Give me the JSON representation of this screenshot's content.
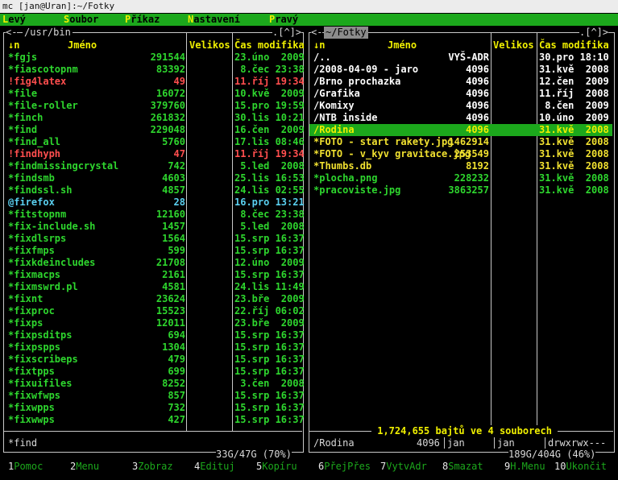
{
  "window": {
    "title": "mc [jan@Uran]:~/Fotky"
  },
  "menu": [
    {
      "hotkey": "L",
      "rest": "evý"
    },
    {
      "hotkey": "S",
      "rest": "oubor"
    },
    {
      "hotkey": "P",
      "rest": "říkaz"
    },
    {
      "hotkey": "N",
      "rest": "astavení"
    },
    {
      "hotkey": "P",
      "rest": "ravý"
    }
  ],
  "left": {
    "path": "/usr/bin",
    "nav_left": "<-",
    "nav_right": ".[^]>",
    "cols": {
      "name": "↓n",
      "name_label": "Jméno",
      "size": "Velikos",
      "time": "Čas modifika"
    },
    "rows": [
      {
        "n": "*fgjs",
        "s": "291544",
        "t": "23.úno  2009",
        "k": "exe"
      },
      {
        "n": "*fiascotopnm",
        "s": "83392",
        "t": " 8.čec 23:38",
        "k": "exe"
      },
      {
        "n": "!fig4latex",
        "s": "49",
        "t": "11.říj 19:34",
        "k": "broken"
      },
      {
        "n": "*file",
        "s": "16072",
        "t": "10.kvě  2009",
        "k": "exe"
      },
      {
        "n": "*file-roller",
        "s": "379760",
        "t": "15.pro 19:59",
        "k": "exe"
      },
      {
        "n": "*finch",
        "s": "261832",
        "t": "30.lis 10:21",
        "k": "exe"
      },
      {
        "n": "*find",
        "s": "229048",
        "t": "16.čen  2009",
        "k": "exe"
      },
      {
        "n": "*find_all",
        "s": "5760",
        "t": "17.lis 08:46",
        "k": "exe"
      },
      {
        "n": "!findhyph",
        "s": "47",
        "t": "11.říj 19:34",
        "k": "broken"
      },
      {
        "n": "*findmissingcrystal",
        "s": "742",
        "t": " 5.led  2008",
        "k": "exe"
      },
      {
        "n": "*findsmb",
        "s": "4603",
        "t": "25.lis 16:53",
        "k": "exe"
      },
      {
        "n": "*findssl.sh",
        "s": "4857",
        "t": "24.lis 02:55",
        "k": "exe"
      },
      {
        "n": "@firefox",
        "s": "28",
        "t": "16.pro 13:21",
        "k": "link"
      },
      {
        "n": "*fitstopnm",
        "s": "12160",
        "t": " 8.čec 23:38",
        "k": "exe"
      },
      {
        "n": "*fix-include.sh",
        "s": "1457",
        "t": " 5.led  2008",
        "k": "exe"
      },
      {
        "n": "*fixdlsrps",
        "s": "1564",
        "t": "15.srp 16:37",
        "k": "exe"
      },
      {
        "n": "*fixfmps",
        "s": "599",
        "t": "15.srp 16:37",
        "k": "exe"
      },
      {
        "n": "*fixkdeincludes",
        "s": "21708",
        "t": "12.úno  2009",
        "k": "exe"
      },
      {
        "n": "*fixmacps",
        "s": "2161",
        "t": "15.srp 16:37",
        "k": "exe"
      },
      {
        "n": "*fixmswrd.pl",
        "s": "4581",
        "t": "24.lis 11:49",
        "k": "exe"
      },
      {
        "n": "*fixnt",
        "s": "23624",
        "t": "23.bře  2009",
        "k": "exe"
      },
      {
        "n": "*fixproc",
        "s": "15523",
        "t": "22.říj 06:02",
        "k": "exe"
      },
      {
        "n": "*fixps",
        "s": "12011",
        "t": "23.bře  2009",
        "k": "exe"
      },
      {
        "n": "*fixpsditps",
        "s": "694",
        "t": "15.srp 16:37",
        "k": "exe"
      },
      {
        "n": "*fixpspps",
        "s": "1304",
        "t": "15.srp 16:37",
        "k": "exe"
      },
      {
        "n": "*fixscribeps",
        "s": "479",
        "t": "15.srp 16:37",
        "k": "exe"
      },
      {
        "n": "*fixtpps",
        "s": "699",
        "t": "15.srp 16:37",
        "k": "exe"
      },
      {
        "n": "*fixuifiles",
        "s": "8252",
        "t": " 3.čen  2008",
        "k": "exe"
      },
      {
        "n": "*fixwfwps",
        "s": "857",
        "t": "15.srp 16:37",
        "k": "exe"
      },
      {
        "n": "*fixwpps",
        "s": "732",
        "t": "15.srp 16:37",
        "k": "exe"
      },
      {
        "n": "*fixwwps",
        "s": "427",
        "t": "15.srp 16:37",
        "k": "exe"
      }
    ],
    "info": "*find",
    "disk": "33G/47G (70%)"
  },
  "right": {
    "path": "~/Fotky",
    "nav_left": "<-",
    "nav_right": ".[^]>",
    "cols": {
      "name": "↓n",
      "name_label": "Jméno",
      "size": "Velikos",
      "time": "Čas modifika"
    },
    "rows": [
      {
        "n": "/..",
        "s": "VYŠ-ADR",
        "t": "30.pro 18:10",
        "k": "dir"
      },
      {
        "n": "/2008-04-09 - jaro",
        "s": "4096",
        "t": "31.kvě  2008",
        "k": "dir"
      },
      {
        "n": "/Brno prochazka",
        "s": "4096",
        "t": "12.čen  2009",
        "k": "dir"
      },
      {
        "n": "/Grafika",
        "s": "4096",
        "t": "11.říj  2008",
        "k": "dir"
      },
      {
        "n": "/Komixy",
        "s": "4096",
        "t": " 8.čen  2009",
        "k": "dir"
      },
      {
        "n": "/NTB inside",
        "s": "4096",
        "t": "10.úno  2009",
        "k": "dir"
      },
      {
        "n": "/Rodina",
        "s": "4096",
        "t": "31.kvě  2008",
        "k": "sel"
      },
      {
        "n": "*FOTO - start rakety.jpg",
        "s": "1462914",
        "t": "31.kvě  2008",
        "k": "yellow"
      },
      {
        "n": "*FOTO - v_kyv gravitace.jpg",
        "s": "253549",
        "t": "31.kvě  2008",
        "k": "yellow"
      },
      {
        "n": "*Thumbs.db",
        "s": "8192",
        "t": "31.kvě  2008",
        "k": "yellow"
      },
      {
        "n": "*plocha.png",
        "s": "228232",
        "t": "31.kvě  2008",
        "k": "exe"
      },
      {
        "n": "*pracoviste.jpg",
        "s": "3863257",
        "t": "31.kvě  2008",
        "k": "exe"
      }
    ],
    "summary": " 1,724,655 bajtů ve 4 souborech ",
    "info": "/Rodina",
    "info_size": "4096",
    "info_user": "jan",
    "info_group": "jan",
    "info_perm": "drwxrwx---",
    "disk": "189G/404G (46%)"
  },
  "fkeys": [
    {
      "num": "1",
      "label": "Pomoc"
    },
    {
      "num": "2",
      "label": "Menu"
    },
    {
      "num": "3",
      "label": "Zobraz"
    },
    {
      "num": "4",
      "label": "Edituj"
    },
    {
      "num": "5",
      "label": "Kopíru"
    },
    {
      "num": "6",
      "label": "PřejPřes"
    },
    {
      "num": "7",
      "label": "VytvAdr"
    },
    {
      "num": "8",
      "label": "Smazat"
    },
    {
      "num": "9",
      "label": "H.Menu"
    },
    {
      "num": "10",
      "label": "Ukončit"
    }
  ],
  "colors": {
    "accent": "#1ca81c",
    "highlight": "#f0f000",
    "executable": "#2ed62e",
    "broken": "#ff4e4e",
    "link": "#5ad0f0"
  }
}
